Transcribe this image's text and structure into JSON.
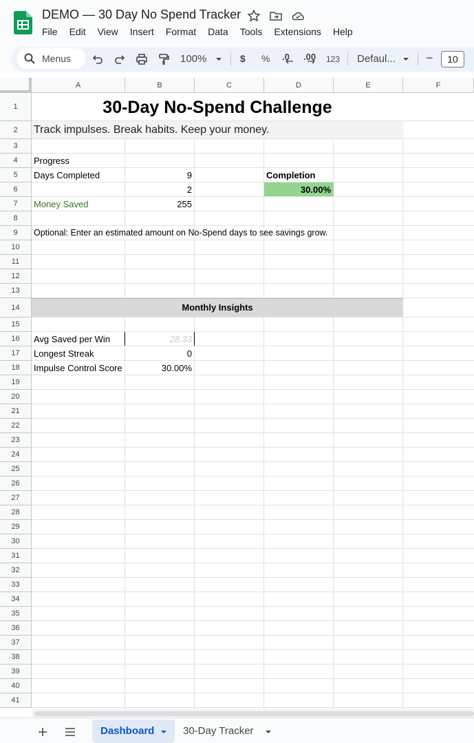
{
  "app": {
    "doc_title": "DEMO — 30 Day No Spend Tracker",
    "menu": [
      "File",
      "Edit",
      "View",
      "Insert",
      "Format",
      "Data",
      "Tools",
      "Extensions",
      "Help"
    ]
  },
  "toolbar": {
    "search_label": "Menus",
    "zoom": "100%",
    "currency": "$",
    "percent": "%",
    "decrease_decimal": ".0",
    "increase_decimal": ".00",
    "number_format": "123",
    "font": "Defaul...",
    "font_size": "10",
    "decrease_font": "−"
  },
  "columns": [
    "A",
    "B",
    "C",
    "D",
    "E",
    "F"
  ],
  "rows": [
    "1",
    "2",
    "3",
    "4",
    "5",
    "6",
    "7",
    "8",
    "9",
    "10",
    "11",
    "12",
    "13",
    "14",
    "15",
    "16",
    "17",
    "18",
    "19",
    "20",
    "21",
    "22",
    "23",
    "24",
    "25",
    "26",
    "27",
    "28",
    "29",
    "30",
    "31",
    "32",
    "33",
    "34",
    "35",
    "36",
    "37",
    "38",
    "39",
    "40",
    "41"
  ],
  "cells": {
    "title": "30-Day No-Spend Challenge",
    "subtitle": "Track impulses. Break habits. Keep your money.",
    "progress_label": "Progress",
    "days_completed_label": "Days Completed",
    "days_completed_value": "9",
    "b6_value": "2",
    "completion_label": "Completion",
    "completion_value": "30.00%",
    "money_saved_label": "Money Saved",
    "money_saved_value": "255",
    "optional_note": "Optional: Enter an estimated amount on No-Spend days to see savings grow.",
    "insights_header": "Monthly Insights",
    "avg_saved_label": "Avg Saved per Win",
    "avg_saved_value": "28.33",
    "longest_streak_label": "Longest Streak",
    "longest_streak_value": "0",
    "impulse_label": "Impulse Control Score",
    "impulse_value": "30.00%"
  },
  "sheets": {
    "active": "Dashboard",
    "other": "30-Day Tracker"
  },
  "colors": {
    "brand_green": "#0f9d58",
    "completion_fill": "#93d58f",
    "money_saved_text": "#38761d",
    "insights_fill": "#d9d9d9",
    "subtitle_fill": "#f3f3f3",
    "active_tab_fill": "#e1e9f7",
    "active_tab_text": "#0b57d0"
  }
}
